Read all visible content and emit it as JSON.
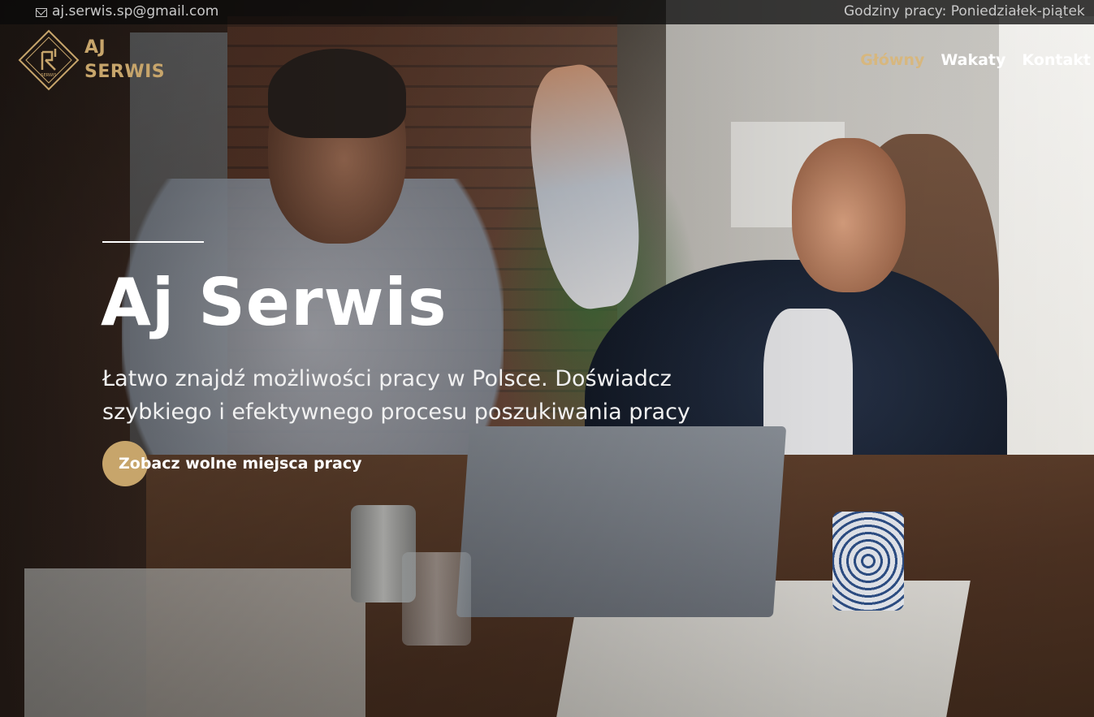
{
  "topbar": {
    "email": "aj.serwis.sp@gmail.com",
    "hours": "Godziny pracy: Poniedziałek-piątek"
  },
  "logo": {
    "line1": "AJ",
    "line2": "SERWIS",
    "mark_text": "SERWIS"
  },
  "nav": {
    "items": [
      {
        "label": "Główny",
        "active": true
      },
      {
        "label": "Wakaty",
        "active": false
      },
      {
        "label": "Kontakt",
        "active": false
      }
    ]
  },
  "hero": {
    "title": "Aj Serwis",
    "subtitle": "Łatwo znajdź możliwości pracy w Polsce. Doświadcz szybkiego i efektywnego procesu poszukiwania pracy",
    "cta_label": "Zobacz wolne miejsca pracy"
  },
  "colors": {
    "accent": "#c7a56b",
    "nav_active": "#d7b77e",
    "text": "#ffffff"
  }
}
